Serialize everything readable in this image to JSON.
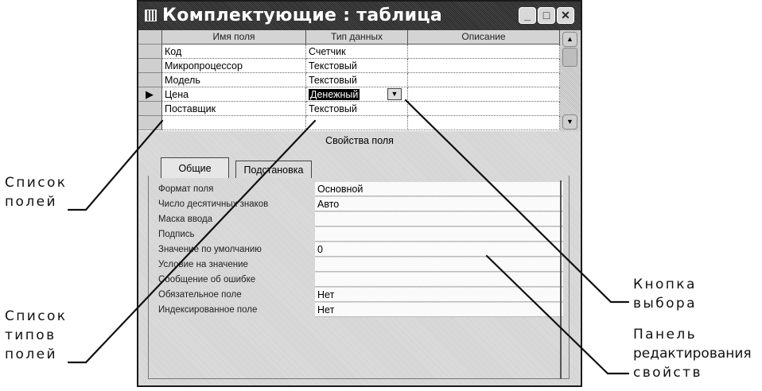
{
  "window": {
    "title": "Комплектующие : таблица",
    "buttons": {
      "minimize": "_",
      "maximize": "□",
      "close": "✕"
    }
  },
  "field_grid": {
    "columns": [
      "Имя поля",
      "Тип данных",
      "Описание"
    ],
    "rows": [
      {
        "name": "Код",
        "type": "Счетчик",
        "description": ""
      },
      {
        "name": "Микропроцессор",
        "type": "Текстовый",
        "description": ""
      },
      {
        "name": "Модель",
        "type": "Текстовый",
        "description": ""
      },
      {
        "name": "Цена",
        "type": "Денежный",
        "description": "",
        "current": true
      },
      {
        "name": "Поставщик",
        "type": "Текстовый",
        "description": ""
      }
    ],
    "row_pointer": "▶"
  },
  "properties": {
    "title": "Свойства поля",
    "tabs": [
      "Общие",
      "Подстановка"
    ],
    "active_tab": "Общие",
    "rows": [
      {
        "label": "Формат поля",
        "value": "Основной"
      },
      {
        "label": "Число десятичных знаков",
        "value": "Авто"
      },
      {
        "label": "Маска ввода",
        "value": ""
      },
      {
        "label": "Подпись",
        "value": ""
      },
      {
        "label": "Значение по умолчанию",
        "value": "0"
      },
      {
        "label": "Условие на значение",
        "value": ""
      },
      {
        "label": "Сообщение об ошибке",
        "value": ""
      },
      {
        "label": "Обязательное поле",
        "value": "Нет"
      },
      {
        "label": "Индексированное поле",
        "value": "Нет"
      }
    ]
  },
  "callouts": {
    "fields_list": [
      "Список",
      "полей"
    ],
    "types_list": [
      "Список",
      "типов",
      "полей"
    ],
    "choose_button": [
      "Кнопка",
      "выбора"
    ],
    "properties_panel": [
      "Панель",
      "редактирования",
      "свойств"
    ]
  }
}
